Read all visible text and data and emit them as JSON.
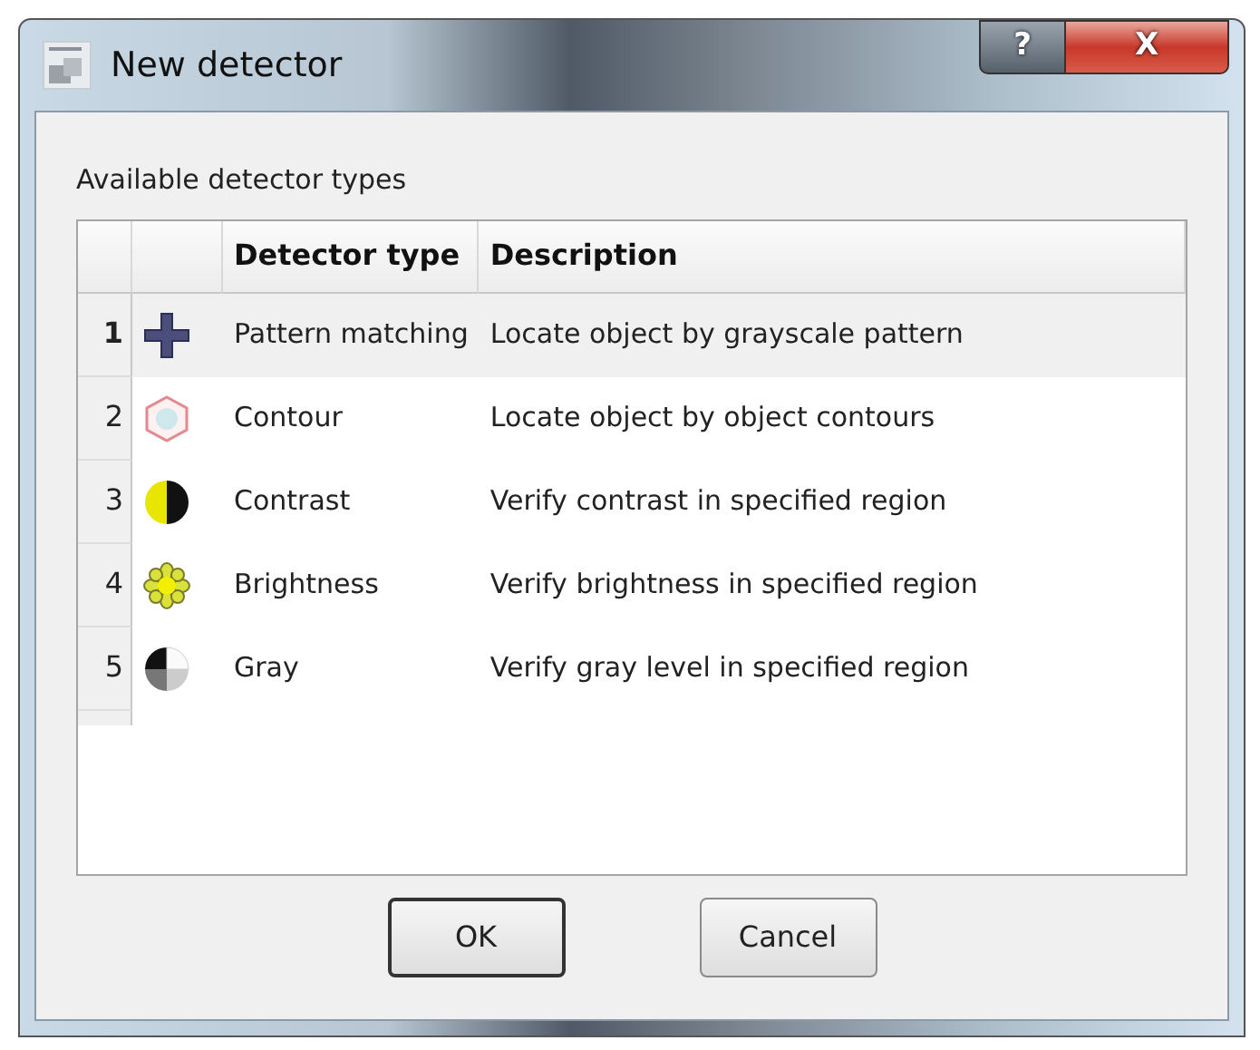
{
  "window": {
    "title": "New detector",
    "buttons": [
      {
        "kind": "help",
        "label": "?"
      },
      {
        "kind": "close",
        "label": "X"
      }
    ]
  },
  "group_label": "Available detector types",
  "table": {
    "columns": [
      "Detector type",
      "Description"
    ],
    "rows": [
      {
        "number": "1",
        "kind": "pattern",
        "type": "Pattern matching",
        "description": "Locate object by grayscale pattern",
        "selected": true
      },
      {
        "number": "2",
        "kind": "contour",
        "type": "Contour",
        "description": "Locate object by object contours",
        "selected": false
      },
      {
        "number": "3",
        "kind": "contrast",
        "type": "Contrast",
        "description": "Verify contrast in specified region",
        "selected": false
      },
      {
        "number": "4",
        "kind": "brightness",
        "type": "Brightness",
        "description": "Verify brightness in specified region",
        "selected": false
      },
      {
        "number": "5",
        "kind": "gray",
        "type": "Gray",
        "description": "Verify gray level in specified region",
        "selected": false
      }
    ]
  },
  "buttons": [
    {
      "label": "OK",
      "default": true
    },
    {
      "label": "Cancel",
      "default": false
    }
  ]
}
